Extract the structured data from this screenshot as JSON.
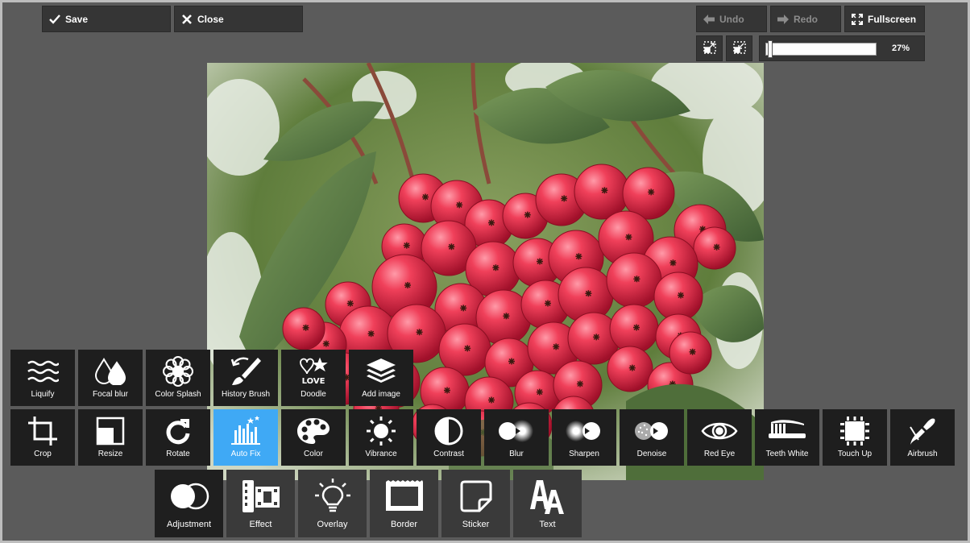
{
  "toolbar": {
    "save_label": "Save",
    "close_label": "Close",
    "undo_label": "Undo",
    "redo_label": "Redo",
    "fullscreen_label": "Fullscreen"
  },
  "zoom": {
    "percent_label": "27%",
    "value": 0.27
  },
  "tools_row1": [
    {
      "label": "Liquify",
      "icon": "waves-icon"
    },
    {
      "label": "Focal blur",
      "icon": "drops-icon"
    },
    {
      "label": "Color Splash",
      "icon": "flower-icon"
    },
    {
      "label": "History Brush",
      "icon": "brush-icon"
    },
    {
      "label": "Doodle",
      "icon": "doodle-icon"
    },
    {
      "label": "Add image",
      "icon": "layers-icon"
    }
  ],
  "tools_row2": [
    {
      "label": "Crop",
      "icon": "crop-icon"
    },
    {
      "label": "Resize",
      "icon": "resize-icon"
    },
    {
      "label": "Rotate",
      "icon": "rotate-icon"
    },
    {
      "label": "Auto Fix",
      "icon": "autofix-icon",
      "active": true
    },
    {
      "label": "Color",
      "icon": "palette-icon"
    },
    {
      "label": "Vibrance",
      "icon": "sun-icon"
    },
    {
      "label": "Contrast",
      "icon": "contrast-icon"
    },
    {
      "label": "Blur",
      "icon": "blur-icon"
    },
    {
      "label": "Sharpen",
      "icon": "sharpen-icon"
    },
    {
      "label": "Denoise",
      "icon": "denoise-icon"
    },
    {
      "label": "Red Eye",
      "icon": "eye-icon"
    },
    {
      "label": "Teeth White",
      "icon": "toothbrush-icon"
    },
    {
      "label": "Touch Up",
      "icon": "touchup-icon"
    },
    {
      "label": "Airbrush",
      "icon": "airbrush-icon"
    }
  ],
  "categories": [
    {
      "label": "Adjustment",
      "icon": "adjustment-icon",
      "active": true
    },
    {
      "label": "Effect",
      "icon": "film-icon"
    },
    {
      "label": "Overlay",
      "icon": "bulb-icon"
    },
    {
      "label": "Border",
      "icon": "border-icon"
    },
    {
      "label": "Sticker",
      "icon": "sticker-icon"
    },
    {
      "label": "Text",
      "icon": "text-icon"
    }
  ],
  "colors": {
    "background": "#5b5b5b",
    "button": "#353535",
    "tool_tile": "#1e1e1e",
    "active_accent": "#3fa9f5",
    "category_tile": "#3a3a3a"
  }
}
